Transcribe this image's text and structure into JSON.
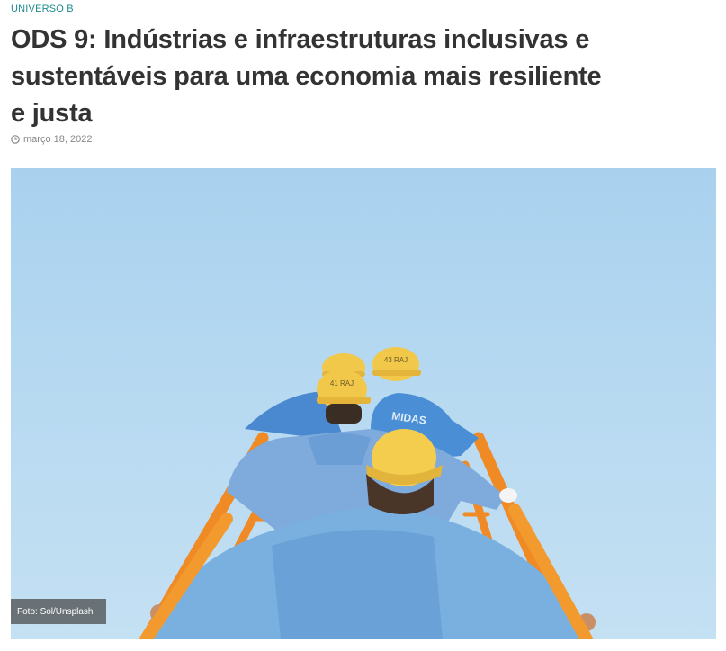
{
  "article": {
    "category": "UNIVERSO B",
    "title": "ODS 9: Indústrias e infraestruturas inclusivas e sustentáveis para uma economia mais resiliente e justa",
    "date": "março 18, 2022",
    "date_icon": "clock-icon"
  },
  "hero_image": {
    "helmet_label_1": "41\nRAJ",
    "helmet_label_2": "43\nRAJ",
    "shirt_label": "MIDAS",
    "caption": "Foto: Sol/Unsplash"
  },
  "colors": {
    "category": "#1f8a8f",
    "title": "#333333",
    "sky": "#b6d9f1",
    "ladder": "#f08a24",
    "helmet": "#f2c84b",
    "shirt": "#5a9ad6"
  }
}
